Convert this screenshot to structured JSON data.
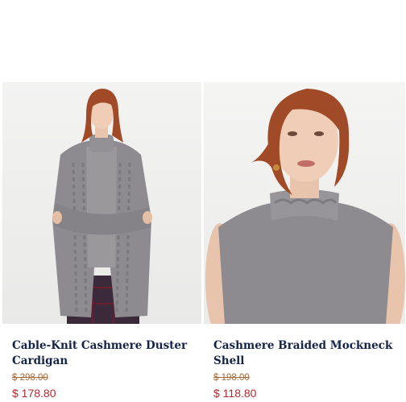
{
  "products": [
    {
      "image_alt": "Model wearing grey cable-knit cashmere duster cardigan over a mockneck sweater",
      "name": "Cable-Knit Cashmere Duster Cardigan",
      "original_price": "$ 298.00",
      "sale_price": "$ 178.80"
    },
    {
      "image_alt": "Model wearing grey cashmere braided mockneck shell",
      "name": "Cashmere Braided Mockneck Shell",
      "original_price": "$ 198.00",
      "sale_price": "$ 118.80"
    }
  ],
  "colors": {
    "product_name": "#14234a",
    "original_price": "#a7683a",
    "sale_price": "#b5282d",
    "garment": "#8d8b8f",
    "hair": "#a04a28"
  }
}
